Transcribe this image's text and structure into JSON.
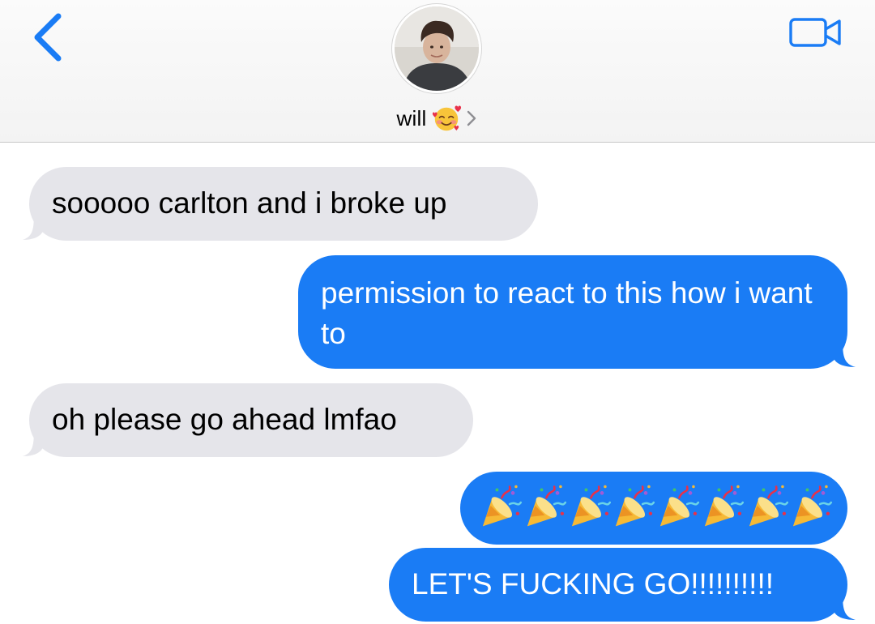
{
  "header": {
    "contact_name": "will",
    "contact_emoji": "smiling-face-with-hearts-emoji",
    "back_icon": "chevron-left-icon",
    "video_icon": "video-camera-icon"
  },
  "colors": {
    "accent": "#1a7cf5",
    "incoming_bubble": "#e5e5ea",
    "header_bg": "#f6f6f6"
  },
  "messages": [
    {
      "direction": "incoming",
      "text": "sooooo carlton and i broke up"
    },
    {
      "direction": "outgoing",
      "text": "permission to react to this how i want to"
    },
    {
      "direction": "incoming",
      "text": "oh please go ahead lmfao"
    },
    {
      "direction": "outgoing",
      "emoji": "party-popper-emoji",
      "count": 8
    },
    {
      "direction": "outgoing",
      "text": "LET'S FUCKING GO!!!!!!!!!!"
    }
  ]
}
